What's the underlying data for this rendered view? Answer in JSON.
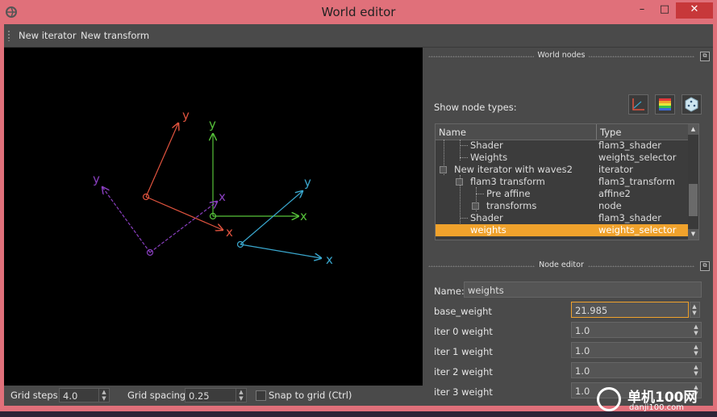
{
  "window": {
    "title": "World editor",
    "minimize": "–",
    "maximize": "□",
    "close": "✕"
  },
  "toolbar": {
    "new_iterator": "New iterator",
    "new_transform": "New transform"
  },
  "canvas": {
    "axis_labels": {
      "red_y": "y",
      "red_x": "x",
      "green_y": "y",
      "green_x": "x",
      "purple_y": "y",
      "purple_x": "x",
      "blue_y": "y",
      "blue_x": "x"
    },
    "colors": {
      "red": "#e0533e",
      "green": "#56c23a",
      "purple": "#8a3fc0",
      "blue": "#3aa8cf"
    }
  },
  "statusbar": {
    "grid_steps_label": "Grid steps:",
    "grid_steps_value": "4.0",
    "grid_spacing_label": "Grid spacing:",
    "grid_spacing_value": "0.25",
    "snap_label": "Snap to grid (Ctrl)"
  },
  "world_nodes": {
    "title": "World nodes",
    "show_types_label": "Show node types:",
    "columns": {
      "name": "Name",
      "type": "Type"
    },
    "rows": [
      {
        "name": "Shader",
        "type": "flam3_shader"
      },
      {
        "name": "Weights",
        "type": "weights_selector"
      },
      {
        "name": "New iterator with waves2",
        "type": "iterator"
      },
      {
        "name": "flam3 transform",
        "type": "flam3_transform"
      },
      {
        "name": "Pre affine",
        "type": "affine2"
      },
      {
        "name": "transforms",
        "type": "node"
      },
      {
        "name": "Shader",
        "type": "flam3_shader"
      },
      {
        "name": "weights",
        "type": "weights_selector"
      }
    ]
  },
  "node_editor": {
    "title": "Node editor",
    "name_label": "Name:",
    "name_value": "weights",
    "fields": [
      {
        "label": "base_weight",
        "value": "21.985"
      },
      {
        "label": "iter 0 weight",
        "value": "1.0"
      },
      {
        "label": "iter 1 weight",
        "value": "1.0"
      },
      {
        "label": "iter 2 weight",
        "value": "1.0"
      },
      {
        "label": "iter 3 weight",
        "value": "1.0"
      }
    ]
  },
  "watermark": {
    "brand": "单机100网",
    "url": "danji100.com"
  }
}
